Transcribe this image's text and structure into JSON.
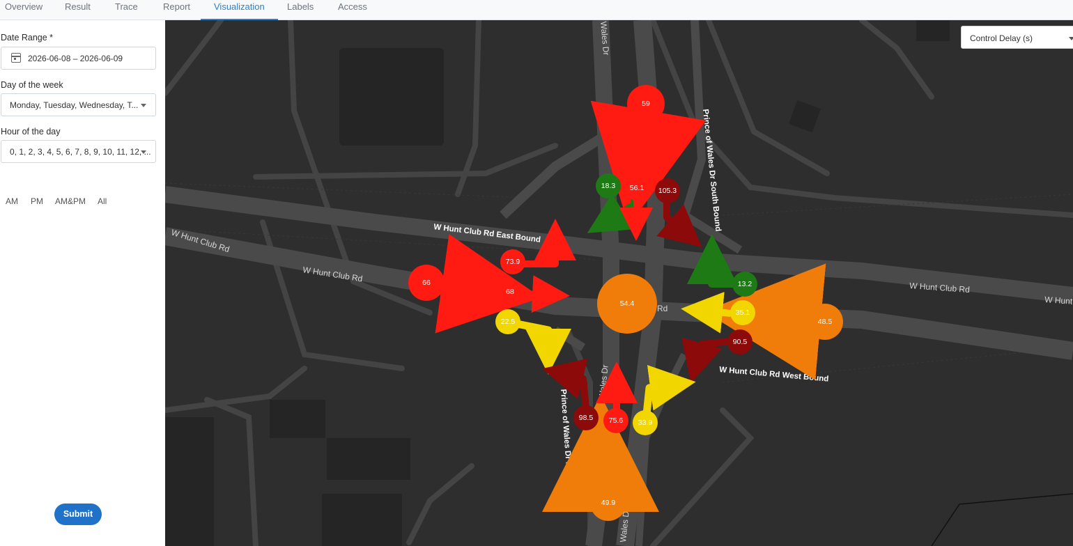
{
  "tabs": [
    "Overview",
    "Result",
    "Trace",
    "Report",
    "Visualization",
    "Labels",
    "Access"
  ],
  "active_tab": "Visualization",
  "sidebar": {
    "date_range_label": "Date Range *",
    "date_range_value": "2026-06-08 – 2026-06-09",
    "day_label": "Day of the week",
    "day_value": "Monday, Tuesday, Wednesday, T...",
    "hour_label": "Hour of the day",
    "hour_value": "0, 1, 2, 3, 4, 5, 6, 7, 8, 9, 10, 11, 12, ...",
    "quick_options": [
      "AM",
      "PM",
      "AM&PM",
      "All"
    ],
    "submit_label": "Submit"
  },
  "map": {
    "metric_select": "Control Delay (s)",
    "road_labels": {
      "eb": "W Hunt Club Rd East Bound",
      "wb": "W Hunt Club Rd West Bound",
      "sb": "Prince of Wales Dr South Bound",
      "nb": "Prince of Wales Dr North Bound",
      "hunt_w1": "W Hunt Club Rd",
      "hunt_w2": "W Hunt Club Rd",
      "hunt_e1": "W Hunt Club Rd",
      "hunt_e2": "W Hunt",
      "rd_frag": "Rd",
      "pow_n1": "Wales Dr",
      "pow_n2": "Prince Of Wa",
      "pow_s1": "Prince Of Wales Dr",
      "pow_s2": "Wales Dr"
    },
    "colors": {
      "green": "#1e7a14",
      "yellow": "#f2d600",
      "orange": "#f07c0a",
      "red": "#ff1a12",
      "darkred": "#8c0a0a"
    },
    "center_value": "54.4",
    "approaches": {
      "sb_total": "59",
      "sb_right": "18.3",
      "sb_thru": "56.1",
      "sb_left": "105.3",
      "eb_total": "66",
      "eb_left": "73.9",
      "eb_thru": "68",
      "eb_right": "22.5",
      "wb_total": "48.5",
      "wb_right": "13.2",
      "wb_thru": "35.1",
      "wb_left": "90.5",
      "nb_total": "49.9",
      "nb_left": "98.5",
      "nb_thru": "75.6",
      "nb_right": "33.9"
    }
  }
}
